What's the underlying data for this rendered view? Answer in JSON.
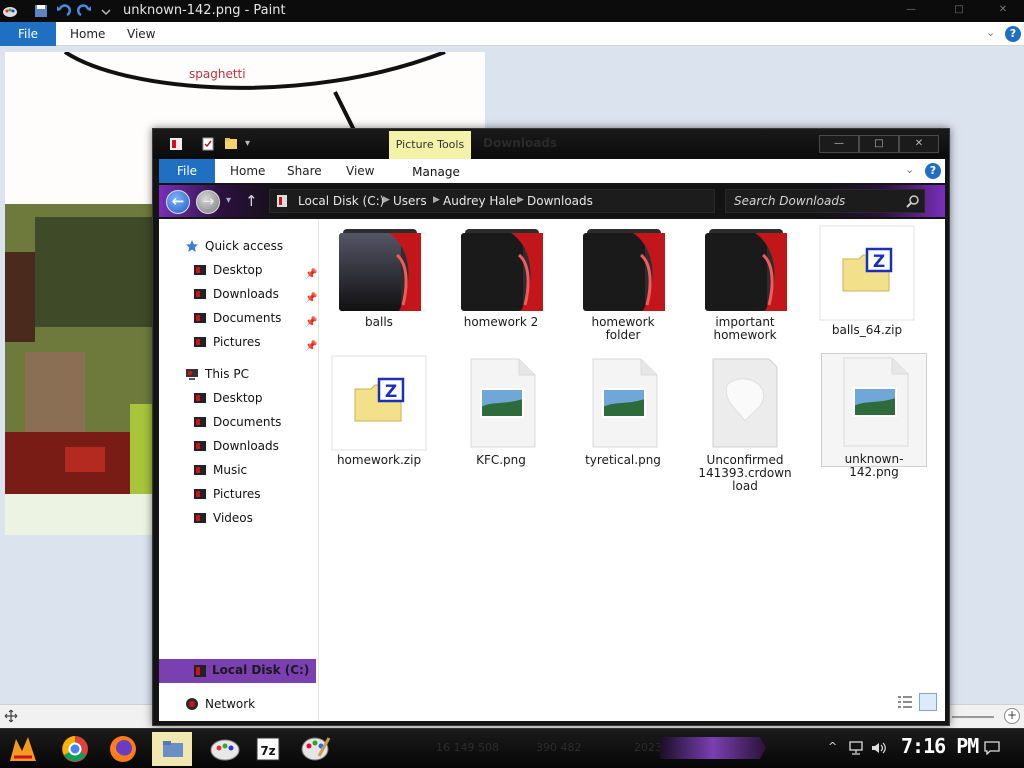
{
  "paint": {
    "title": "unknown-142.png - Paint",
    "ribbon_tabs": {
      "file": "File",
      "home": "Home",
      "view": "View"
    },
    "canvas_text": "spaghetti"
  },
  "explorer": {
    "title": "Downloads",
    "picture_tools_label": "Picture Tools",
    "ribbon_tabs": {
      "file": "File",
      "home": "Home",
      "share": "Share",
      "view": "View",
      "manage": "Manage"
    },
    "breadcrumbs": [
      "Local Disk (C:)",
      "Users",
      "Audrey Hale",
      "Downloads"
    ],
    "search_placeholder": "Search Downloads",
    "nav_pane": {
      "quick_access": "Quick access",
      "quick_access_items": [
        "Desktop",
        "Downloads",
        "Documents",
        "Pictures"
      ],
      "this_pc": "This PC",
      "this_pc_items": [
        "Desktop",
        "Documents",
        "Downloads",
        "Music",
        "Pictures",
        "Videos"
      ],
      "local_disk": "Local Disk (C:)",
      "network": "Network"
    },
    "files": [
      {
        "name": "balls",
        "type": "folder"
      },
      {
        "name": "homework 2",
        "type": "folder"
      },
      {
        "name": "homework folder",
        "type": "folder"
      },
      {
        "name": "important homework",
        "type": "folder"
      },
      {
        "name": "balls_64.zip",
        "type": "zip"
      },
      {
        "name": "homework.zip",
        "type": "zip"
      },
      {
        "name": "KFC.png",
        "type": "image"
      },
      {
        "name": "tyretical.png",
        "type": "image"
      },
      {
        "name": "Unconfirmed 141393.crdownload",
        "type": "crdownload"
      },
      {
        "name": "unknown-142.png",
        "type": "image",
        "selected": true
      }
    ]
  },
  "taskbar": {
    "ghost_text": [
      "16 149 508",
      "390 482",
      "2023-05-12 22"
    ],
    "clock": "7:16 PM"
  },
  "colors": {
    "accent_blue": "#1f6fc2",
    "purple": "#7a3fb0",
    "picture_tools": "#f4f1a8"
  }
}
